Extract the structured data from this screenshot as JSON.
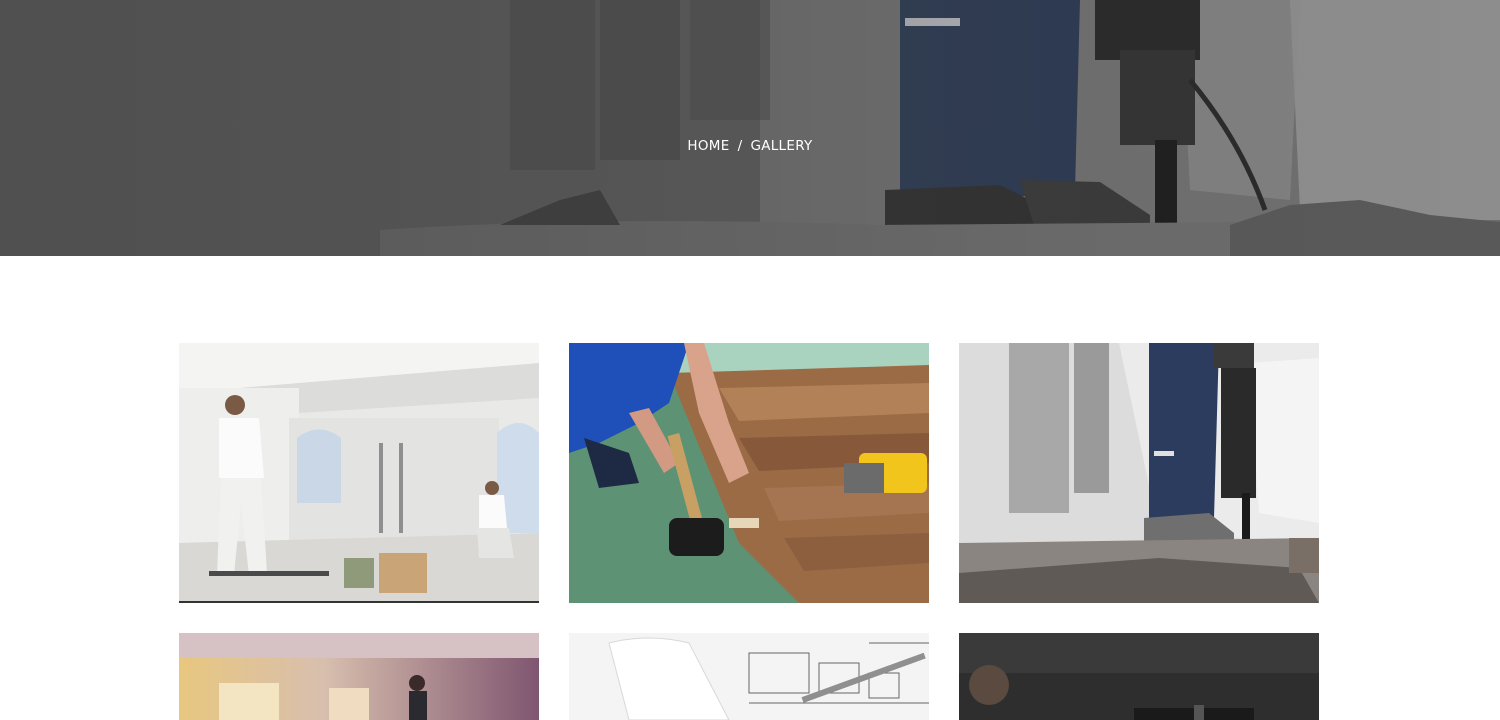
{
  "breadcrumb": {
    "home_label": "HOME",
    "separator": "/",
    "current_label": "GALLERY"
  },
  "gallery": {
    "items": [
      {
        "subject": "painters-interior-room-photo"
      },
      {
        "subject": "laminate-floor-installation-photo"
      },
      {
        "subject": "jackhammer-demolition-photo"
      },
      {
        "subject": "drywall-worker-sunlit-room-photo"
      },
      {
        "subject": "architectural-blueprints-photo"
      },
      {
        "subject": "worker-dark-room-photo"
      }
    ]
  },
  "colors": {
    "hero_gray": "#5c5c5c",
    "breadcrumb_text": "#ffffff",
    "page_background": "#ffffff",
    "floor_green": "#5e9275",
    "wood_brown": "#9a6b45",
    "workwear_blue": "#2c3c5e"
  }
}
